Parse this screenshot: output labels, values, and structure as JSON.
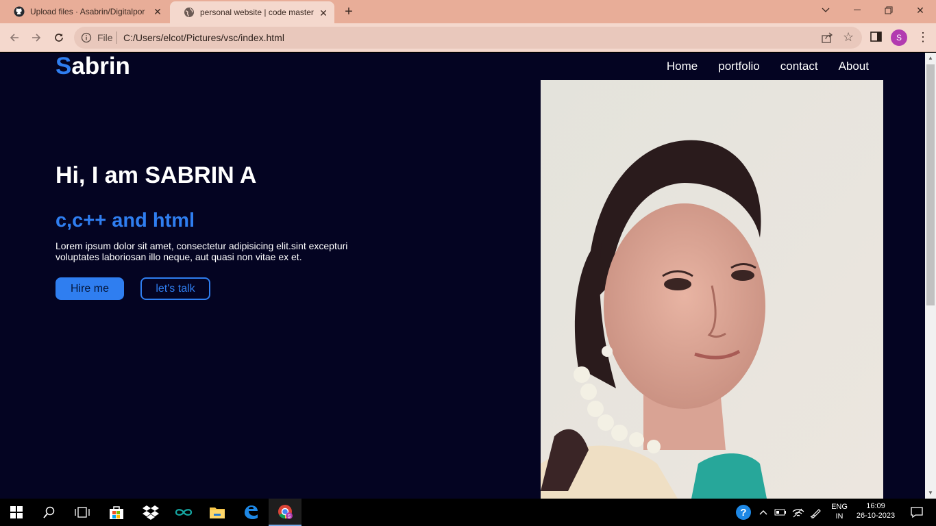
{
  "browser": {
    "tabs": [
      {
        "title": "Upload files · Asabrin/Digitalpor",
        "icon": "github-icon",
        "active": false
      },
      {
        "title": "personal website | code master",
        "icon": "globe-icon",
        "active": true
      }
    ],
    "new_tab_icon": "plus-icon",
    "address": {
      "scheme": "File",
      "url": "C:/Users/elcot/Pictures/vsc/index.html"
    },
    "profile_initial": "S"
  },
  "site": {
    "logo_first": "S",
    "logo_rest": "abrin",
    "nav": [
      "Home",
      "portfolio",
      "contact",
      "About"
    ],
    "greeting": "Hi, I am SABRIN A",
    "skills": "c,c++ and html",
    "description": "Lorem ipsum dolor sit amet, consectetur adipisicing elit.sint excepturi voluptates laboriosan illo neque, aut quasi non vitae ex et.",
    "buttons": {
      "hire": "Hire me",
      "talk": "let's talk"
    },
    "colors": {
      "background": "#040422",
      "accent": "#2f7ef0",
      "text": "#ffffff"
    }
  },
  "taskbar": {
    "language": "ENG",
    "region": "IN",
    "time": "16:09",
    "date": "26-10-2023"
  }
}
